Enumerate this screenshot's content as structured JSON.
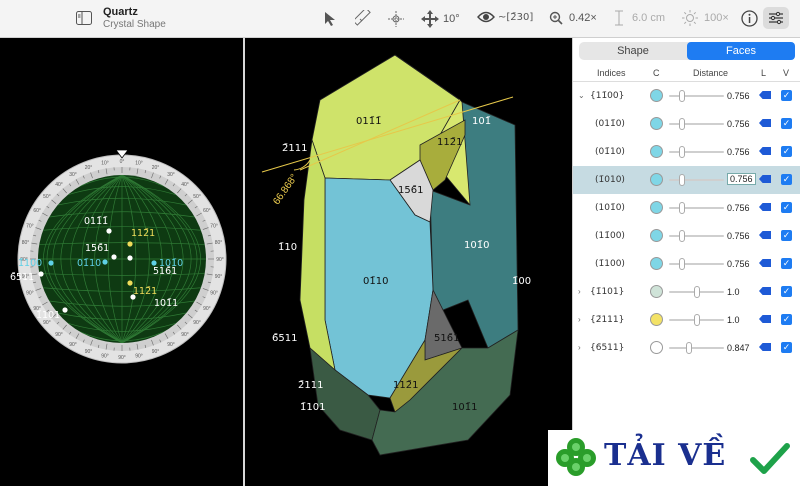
{
  "app": {
    "title": "Quartz",
    "subtitle": "Crystal Shape"
  },
  "toolbar": {
    "rotation": "10°",
    "view_direction": "~[2̄30]",
    "zoom": "0.42×",
    "length": "6.0 cm",
    "brightness": "100×"
  },
  "stereo": {
    "ticks": [
      "0°",
      "10°",
      "20°",
      "30°",
      "40°",
      "50°",
      "60°",
      "70°",
      "80°",
      "90°"
    ],
    "labels": [
      {
        "text": "011̄1̄",
        "color": "#ffffff"
      },
      {
        "text": "112̄1",
        "color": "#f0dc5a"
      },
      {
        "text": "156̄1",
        "color": "#ffffff"
      },
      {
        "text": "01̄10",
        "color": "#5fd0e6"
      },
      {
        "text": "1̄100",
        "color": "#5fd0e6"
      },
      {
        "text": "101̄0",
        "color": "#5fd0e6"
      },
      {
        "text": "516̄1",
        "color": "#ffffff"
      },
      {
        "text": "6̄511",
        "color": "#ffffff"
      },
      {
        "text": "112̄1",
        "color": "#f0dc5a"
      },
      {
        "text": "101̄1",
        "color": "#ffffff"
      },
      {
        "text": "1̄101",
        "color": "#ffffff"
      }
    ]
  },
  "crystal": {
    "angle": "66.868°",
    "face_labels": [
      "011̄1̄",
      "101̄",
      "112̄1",
      "156̄1",
      "2̄111",
      "1̄10",
      "01̄10",
      "101̄0",
      "1̄00",
      "6̄511",
      "516̄1",
      "2̄111",
      "112̄1",
      "1̄101",
      "101̄1"
    ]
  },
  "sidebar": {
    "tabs": [
      "Shape",
      "Faces"
    ],
    "active_tab": "Faces",
    "columns": [
      "Indices",
      "C",
      "Distance",
      "L",
      "V"
    ],
    "rows": [
      {
        "indices": "{11̄00}",
        "color": "#7fd6e6",
        "distance": "0.756",
        "expand": "down"
      },
      {
        "indices": "(011̄0)",
        "color": "#7fd6e6",
        "distance": "0.756"
      },
      {
        "indices": "(01̄10)",
        "color": "#7fd6e6",
        "distance": "0.756"
      },
      {
        "indices": "(1̄010)",
        "color": "#7fd6e6",
        "distance": "0.756",
        "selected": true
      },
      {
        "indices": "(101̄0)",
        "color": "#7fd6e6",
        "distance": "0.756"
      },
      {
        "indices": "(11̄00)",
        "color": "#7fd6e6",
        "distance": "0.756"
      },
      {
        "indices": "(1̄100)",
        "color": "#7fd6e6",
        "distance": "0.756"
      },
      {
        "indices": "{1̄101}",
        "color": "#cfe3d8",
        "distance": "1.0",
        "expand": "right"
      },
      {
        "indices": "{2̄111}",
        "color": "#f3e266",
        "distance": "1.0",
        "expand": "right"
      },
      {
        "indices": "{6̄511}",
        "color": "#ffffff",
        "distance": "0.847",
        "expand": "right"
      }
    ]
  },
  "watermark": {
    "text": "TẢI VỀ"
  }
}
